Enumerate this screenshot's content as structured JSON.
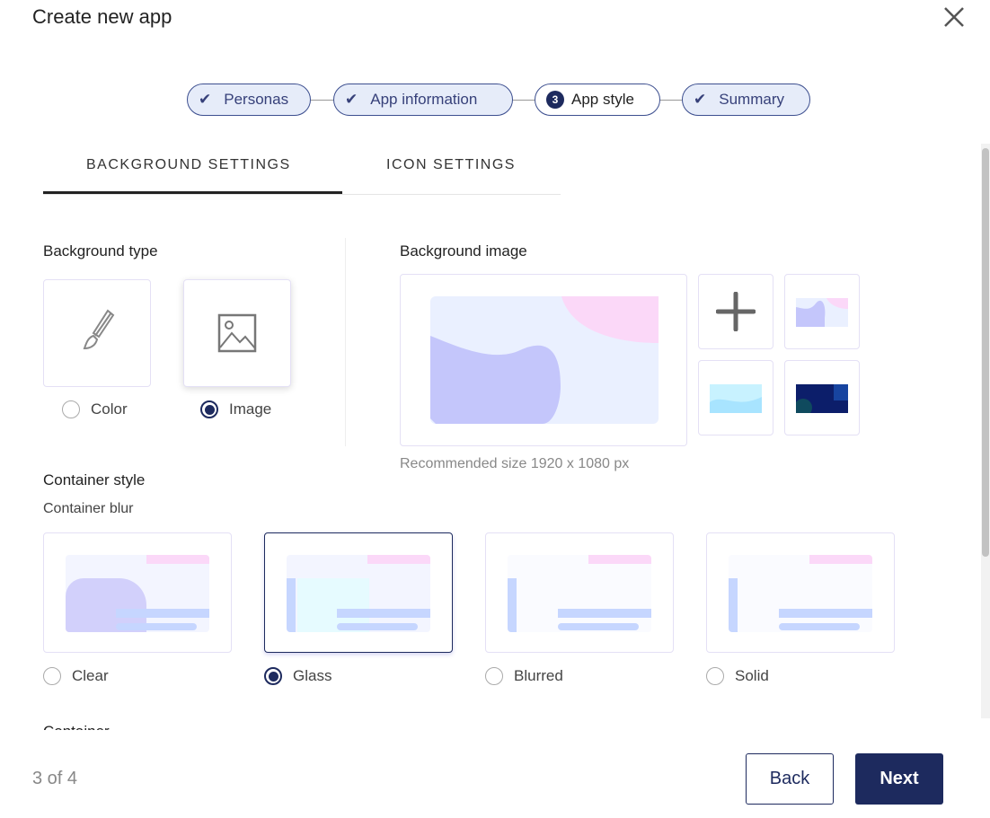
{
  "dialog": {
    "title": "Create new app",
    "close_icon": "close-icon"
  },
  "stepper": [
    {
      "label": "Personas",
      "state": "done"
    },
    {
      "label": "App information",
      "state": "done"
    },
    {
      "label": "App style",
      "state": "current",
      "number": "3"
    },
    {
      "label": "Summary",
      "state": "done"
    }
  ],
  "tabs": [
    {
      "label": "BACKGROUND SETTINGS",
      "active": true
    },
    {
      "label": "ICON SETTINGS",
      "active": false
    }
  ],
  "background_type": {
    "heading": "Background type",
    "options": [
      {
        "label": "Color",
        "icon": "paintbrush-icon",
        "selected": false
      },
      {
        "label": "Image",
        "icon": "image-icon",
        "selected": true
      }
    ]
  },
  "background_image": {
    "heading": "Background image",
    "hint": "Recommended size 1920 x 1080 px",
    "add_icon": "plus-icon"
  },
  "container_style": {
    "heading": "Container style",
    "subheading": "Container blur",
    "options": [
      {
        "label": "Clear",
        "selected": false
      },
      {
        "label": "Glass",
        "selected": true
      },
      {
        "label": "Blurred",
        "selected": false
      },
      {
        "label": "Solid",
        "selected": false
      }
    ],
    "next_heading_partial": "Container"
  },
  "footer": {
    "progress": "3 of 4",
    "back": "Back",
    "next": "Next"
  },
  "colors": {
    "primary": "#1d2a5e",
    "step_bg": "#e6ecf9"
  }
}
